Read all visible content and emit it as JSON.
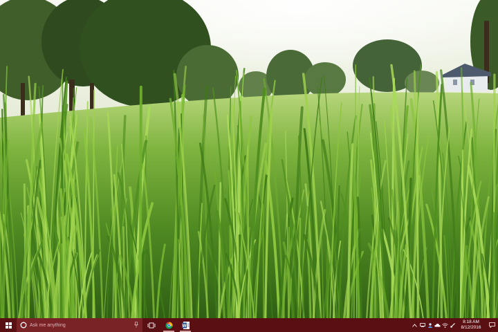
{
  "wallpaper": {
    "scene": "grass-field",
    "sky_color": "#f2f5ec",
    "grass_color": "#5f9b2e"
  },
  "taskbar": {
    "background_color": "#5a0f12",
    "start_icon": "windows-logo-icon",
    "search": {
      "placeholder": "Ask me anything",
      "icon": "cortana-circle-icon",
      "mic_icon": "microphone-icon"
    },
    "task_view_icon": "task-view-icon",
    "pinned_apps": [
      {
        "name": "Google Chrome",
        "icon": "chrome-icon",
        "active": true
      },
      {
        "name": "Microsoft Word",
        "icon": "word-icon",
        "active": true
      }
    ],
    "tray": {
      "icons": [
        "chevron-up-icon",
        "network-device-icon",
        "people-icon",
        "onedrive-cloud-icon",
        "wifi-icon",
        "pen-icon"
      ],
      "time": "8:18 AM",
      "date": "8/12/2016",
      "notification_icon": "action-center-icon"
    }
  }
}
